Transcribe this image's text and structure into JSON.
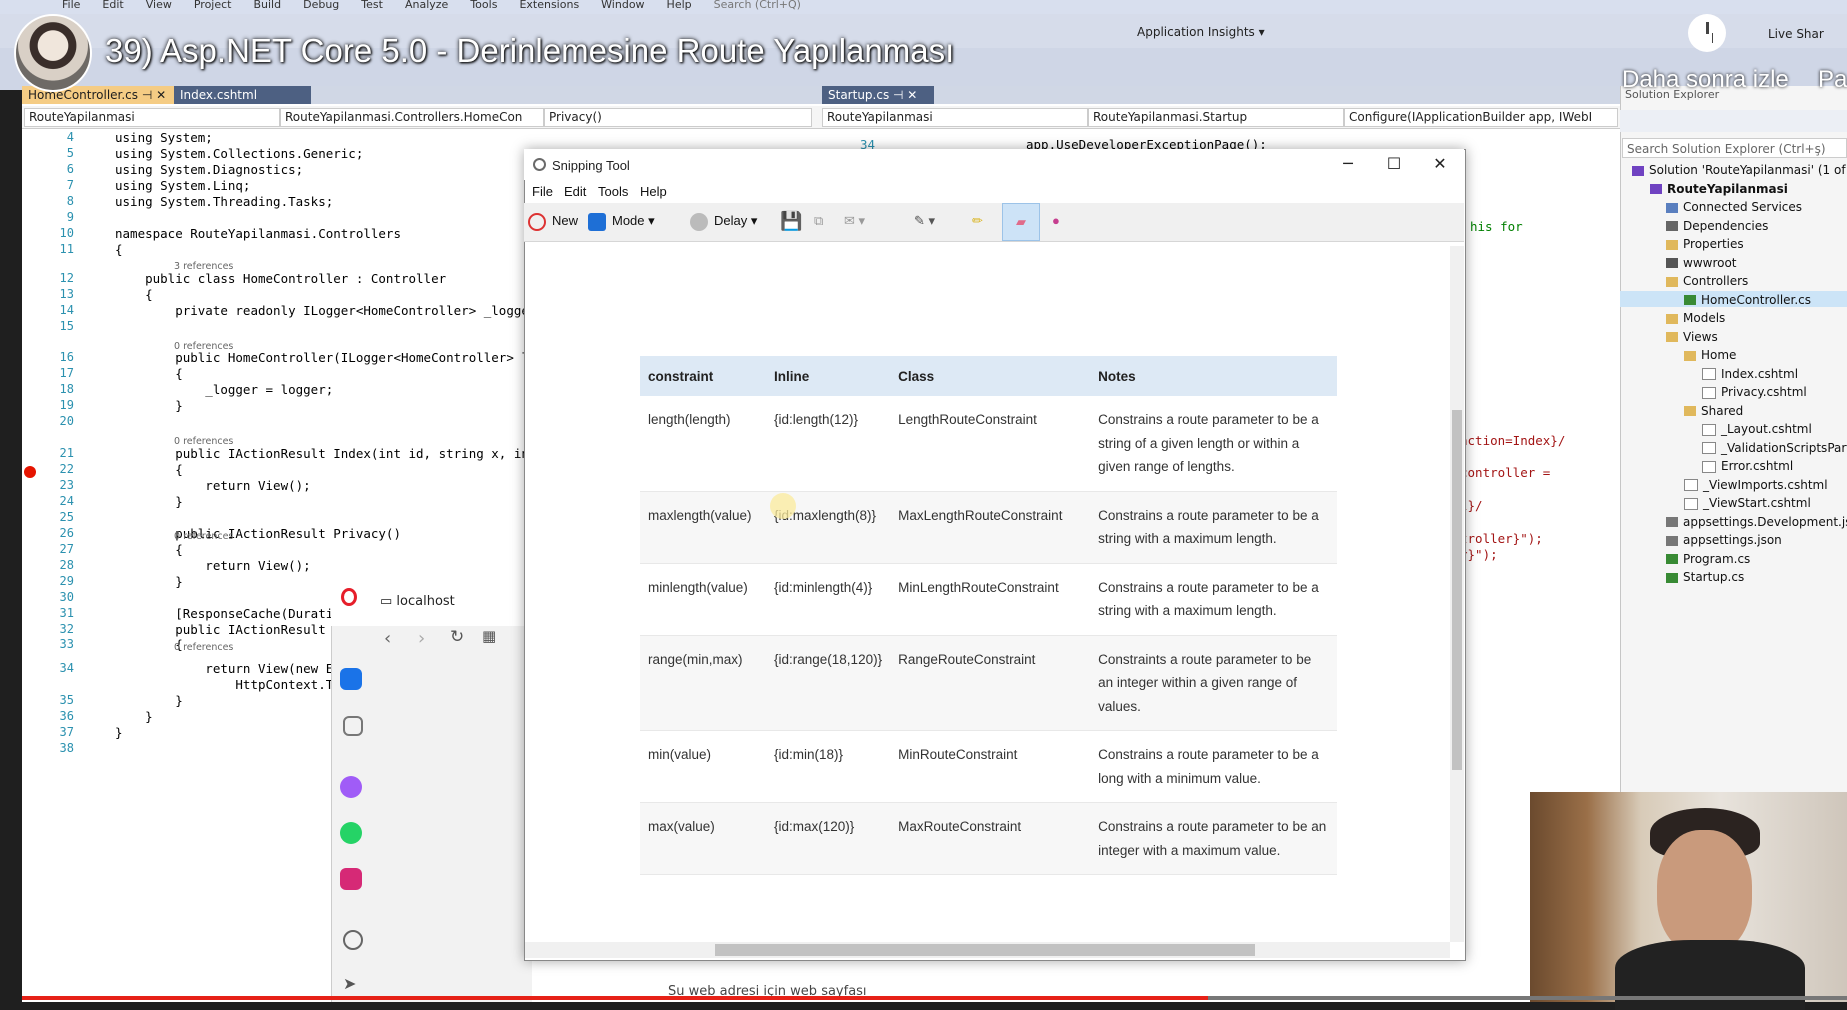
{
  "video": {
    "title": "39) Asp.NET Core 5.0 - Derinlemesine Route Yapılanması",
    "watch_later": "Daha sonra izle",
    "share": "Pa",
    "progress": 0.65
  },
  "vs": {
    "menu": [
      "File",
      "Edit",
      "View",
      "Project",
      "Build",
      "Debug",
      "Test",
      "Analyze",
      "Tools",
      "Extensions",
      "Window",
      "Help"
    ],
    "search_placeholder": "Search (Ctrl+Q)",
    "app_insights": "Application Insights",
    "live_share": "Live Shar",
    "left_tabs": [
      "HomeController.cs",
      "Index.cshtml"
    ],
    "left_nav": [
      "RouteYapilanmasi",
      "RouteYapilanmasi.Controllers.HomeCon",
      "Privacy()"
    ],
    "right_tab": "Startup.cs",
    "right_nav": [
      "RouteYapilanmasi",
      "RouteYapilanmasi.Startup",
      "Configure(IApplicationBuilder app, IWebI"
    ],
    "code_lines": [
      {
        "n": "4",
        "t": "using System;"
      },
      {
        "n": "5",
        "t": "using System.Collections.Generic;"
      },
      {
        "n": "6",
        "t": "using System.Diagnostics;"
      },
      {
        "n": "7",
        "t": "using System.Linq;"
      },
      {
        "n": "8",
        "t": "using System.Threading.Tasks;"
      },
      {
        "n": "9",
        "t": ""
      },
      {
        "n": "10",
        "t": "namespace RouteYapilanmasi.Controllers"
      },
      {
        "n": "11",
        "t": "{"
      },
      {
        "n": "12",
        "t": "    public class HomeController : Controller"
      },
      {
        "n": "13",
        "t": "    {"
      },
      {
        "n": "14",
        "t": "        private readonly ILogger<HomeController> _logger;"
      },
      {
        "n": "15",
        "t": ""
      },
      {
        "n": "16",
        "t": "        public HomeController(ILogger<HomeController> logg"
      },
      {
        "n": "17",
        "t": "        {"
      },
      {
        "n": "18",
        "t": "            _logger = logger;"
      },
      {
        "n": "19",
        "t": "        }"
      },
      {
        "n": "20",
        "t": ""
      },
      {
        "n": "21",
        "t": "        public IActionResult Index(int id, string x, int y"
      },
      {
        "n": "22",
        "t": "        {"
      },
      {
        "n": "23",
        "t": "            return View();"
      },
      {
        "n": "24",
        "t": "        }"
      },
      {
        "n": "25",
        "t": ""
      },
      {
        "n": "26",
        "t": "        public IActionResult Privacy()"
      },
      {
        "n": "27",
        "t": "        {"
      },
      {
        "n": "28",
        "t": "            return View();"
      },
      {
        "n": "29",
        "t": "        }"
      },
      {
        "n": "30",
        "t": ""
      },
      {
        "n": "31",
        "t": "        [ResponseCache(Duration"
      },
      {
        "n": "32",
        "t": "        public IActionResult Er"
      },
      {
        "n": "33",
        "t": "        {"
      },
      {
        "n": "34",
        "t": "            return View(new Er"
      },
      {
        "n": "",
        "t": "                HttpContext.Trace"
      },
      {
        "n": "35",
        "t": "        }"
      },
      {
        "n": "36",
        "t": "    }"
      },
      {
        "n": "37",
        "t": "}"
      },
      {
        "n": "38",
        "t": ""
      }
    ],
    "refs": {
      "r3": "3 references",
      "r0a": "0 references",
      "r0b": "0 references",
      "r0c": "0 references",
      "r0d": "0 references"
    },
    "right_code": {
      "ln34": "34",
      "use_dev": "app.UseDeveloperExceptionPage();",
      "this_for": "his for",
      "action_index": "action=Index}/",
      "controller_eq": "controller =",
      "l_slash": "l}/",
      "troller": "troller}\");",
      "er": "r}\");"
    }
  },
  "solution": {
    "title": "Solution Explorer",
    "search_placeholder": "Search Solution Explorer (Ctrl+ş)",
    "items": [
      {
        "label": "Solution 'RouteYapilanmasi' (1 of 1",
        "icon": "solution"
      },
      {
        "label": "RouteYapilanmasi",
        "icon": "project"
      },
      {
        "label": "Connected Services",
        "icon": "connected"
      },
      {
        "label": "Dependencies",
        "icon": "deps"
      },
      {
        "label": "Properties",
        "icon": "folder"
      },
      {
        "label": "wwwroot",
        "icon": "globe"
      },
      {
        "label": "Controllers",
        "icon": "folder"
      },
      {
        "label": "HomeController.cs",
        "icon": "cs"
      },
      {
        "label": "Models",
        "icon": "folder"
      },
      {
        "label": "Views",
        "icon": "folder"
      },
      {
        "label": "Home",
        "icon": "folder"
      },
      {
        "label": "Index.cshtml",
        "icon": "file"
      },
      {
        "label": "Privacy.cshtml",
        "icon": "file"
      },
      {
        "label": "Shared",
        "icon": "folder"
      },
      {
        "label": "_Layout.cshtml",
        "icon": "file"
      },
      {
        "label": "_ValidationScriptsParti",
        "icon": "file"
      },
      {
        "label": "Error.cshtml",
        "icon": "file"
      },
      {
        "label": "_ViewImports.cshtml",
        "icon": "file"
      },
      {
        "label": "_ViewStart.cshtml",
        "icon": "file"
      },
      {
        "label": "appsettings.Development.jsc",
        "icon": "json"
      },
      {
        "label": "appsettings.json",
        "icon": "json"
      },
      {
        "label": "Program.cs",
        "icon": "cs"
      },
      {
        "label": "Startup.cs",
        "icon": "cs"
      }
    ]
  },
  "browser": {
    "tab": "localhost",
    "bottom_text": "Su web adresi için web sayfası"
  },
  "snip": {
    "title": "Snipping Tool",
    "menu": [
      "File",
      "Edit",
      "Tools",
      "Help"
    ],
    "new": "New",
    "mode": "Mode",
    "delay": "Delay",
    "table": {
      "headers": [
        "constraint",
        "Inline",
        "Class",
        "Notes"
      ],
      "rows": [
        [
          "length(length)",
          "{id:length(12)}",
          "LengthRouteConstraint",
          "Constrains a route parameter to be a string of a given length or within a given range of lengths."
        ],
        [
          "maxlength(value)",
          "{id:maxlength(8)}",
          "MaxLengthRouteConstraint",
          "Constrains a route parameter to be a string with a maximum length."
        ],
        [
          "minlength(value)",
          "{id:minlength(4)}",
          "MinLengthRouteConstraint",
          "Constrains a route parameter to be a string with a maximum length."
        ],
        [
          "range(min,max)",
          "{id:range(18,120)}",
          "RangeRouteConstraint",
          "Constraints a route parameter to be an integer within a given range of values."
        ],
        [
          "min(value)",
          "{id:min(18)}",
          "MinRouteConstraint",
          "Constrains a route parameter to be a long with a minimum value."
        ],
        [
          "max(value)",
          "{id:max(120)}",
          "MaxRouteConstraint",
          "Constrains a route parameter to be an integer with a maximum value."
        ]
      ]
    }
  }
}
